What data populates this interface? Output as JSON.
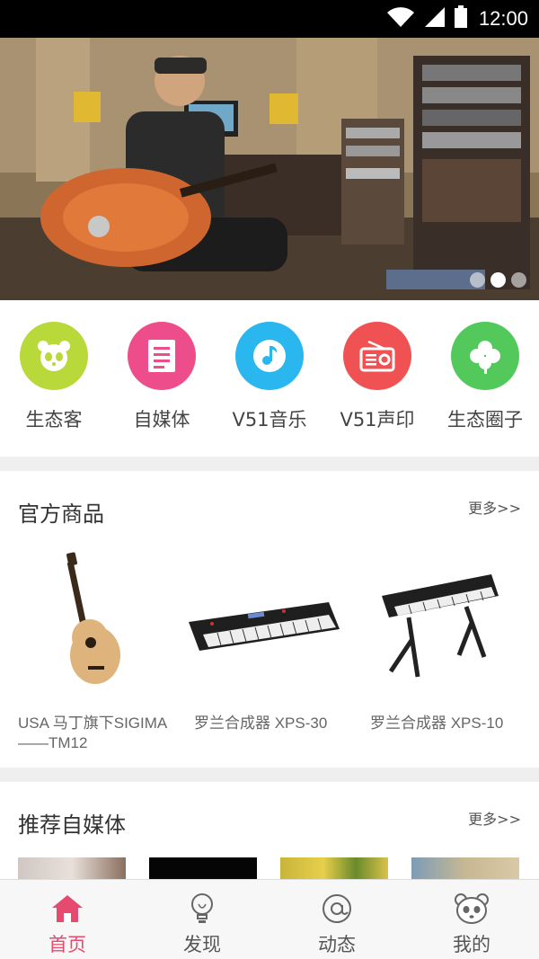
{
  "status_bar": {
    "time": "12:00"
  },
  "banner": {
    "slide_count": 3,
    "active_slide": 2
  },
  "quick_nav": [
    {
      "label": "生态客",
      "icon": "panda-icon",
      "color": "#b9d83a"
    },
    {
      "label": "自媒体",
      "icon": "document-icon",
      "color": "#ee4d8b"
    },
    {
      "label": "V51音乐",
      "icon": "music-note-icon",
      "color": "#2ab6ee"
    },
    {
      "label": "V51声印",
      "icon": "radio-icon",
      "color": "#f05152"
    },
    {
      "label": "生态圈子",
      "icon": "clover-icon",
      "color": "#53c95c"
    }
  ],
  "products_section": {
    "title": "官方商品",
    "more": "更多>>",
    "items": [
      {
        "name": "USA 马丁旗下SIGIMA——TM12",
        "image": "acoustic-guitar"
      },
      {
        "name": "罗兰合成器 XPS-30",
        "image": "synthesizer-keyboard"
      },
      {
        "name": "罗兰合成器 XPS-10",
        "image": "keyboard-on-stand"
      }
    ]
  },
  "media_section": {
    "title": "推荐自媒体",
    "more": "更多>>"
  },
  "tab_bar": {
    "active": "首页",
    "accent": "#e64a6e",
    "tabs": [
      {
        "label": "首页",
        "icon": "home-icon"
      },
      {
        "label": "发现",
        "icon": "lightbulb-icon"
      },
      {
        "label": "动态",
        "icon": "at-icon"
      },
      {
        "label": "我的",
        "icon": "panda-face-icon"
      }
    ]
  }
}
